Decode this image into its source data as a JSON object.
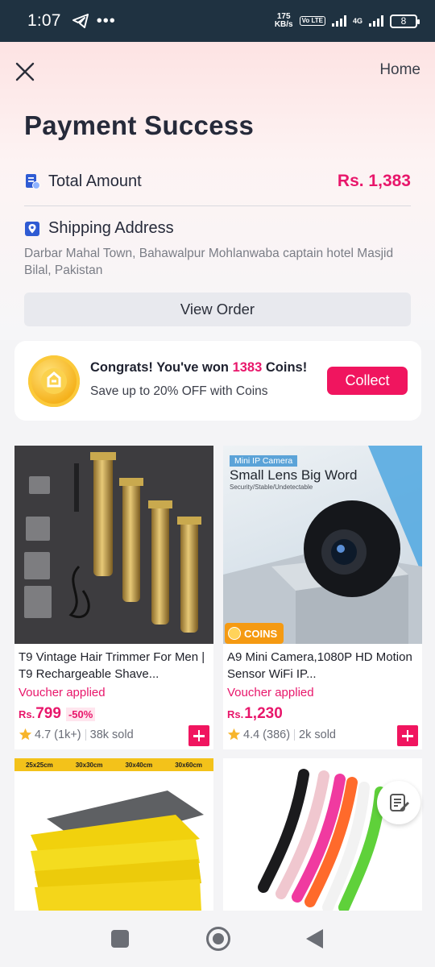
{
  "status_bar": {
    "time": "1:07",
    "net_speed_value": "175",
    "net_speed_unit": "KB/s",
    "volte": "Vo LTE",
    "network": "4G",
    "battery": "8"
  },
  "header": {
    "home_label": "Home",
    "title": "Payment Success"
  },
  "summary": {
    "total_label": "Total Amount",
    "total_value": "Rs. 1,383",
    "shipping_label": "Shipping Address",
    "shipping_address": "Darbar Mahal Town, Bahawalpur Mohlanwaba captain hotel Masjid Bilal, Pakistan",
    "view_order_label": "View Order"
  },
  "coins": {
    "congrats_prefix": "Congrats! You've won ",
    "coins_amount": "1383",
    "congrats_suffix": " Coins!",
    "subtitle": "Save up to 20% OFF with Coins",
    "collect_label": "Collect"
  },
  "products": [
    {
      "title": "T9 Vintage Hair Trimmer For Men | T9 Rechargeable Shave...",
      "voucher": "Voucher applied",
      "currency": "Rs.",
      "price": "799",
      "discount": "-50%",
      "rating": "4.7 (1k+)",
      "sold": "38k sold"
    },
    {
      "title": "A9 Mini Camera,1080P HD Motion Sensor WiFi IP...",
      "voucher": "Voucher applied",
      "currency": "Rs.",
      "price": "1,230",
      "rating": "4.4 (386)",
      "sold": "2k sold",
      "badge": "COINS",
      "image_chip": "Mini IP Camera",
      "image_headline": "Small Lens Big Word",
      "image_subline": "Security/Stable/Undetectable"
    }
  ],
  "towel_sizes": [
    "25x25cm",
    "30x30cm",
    "30x40cm",
    "30x60cm"
  ],
  "colors": {
    "accent": "#f0155f",
    "price": "#e8176b",
    "status_bar": "#1f3241",
    "coins_orange": "#f59a12"
  }
}
